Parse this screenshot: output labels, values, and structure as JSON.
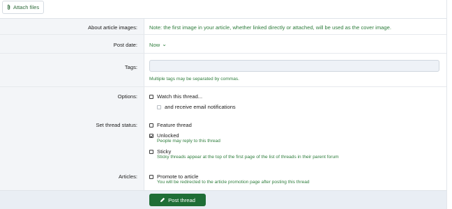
{
  "toolbar": {
    "attach_label": "Attach files"
  },
  "form": {
    "cover": {
      "label": "About article images:",
      "note": "Note: the first image in your article, whether linked directly or attached, will be used as the cover image."
    },
    "post_date": {
      "label": "Post date:",
      "value": "Now",
      "chevron": "⌄"
    },
    "tags": {
      "label": "Tags:",
      "value": "",
      "hint": "Multiple tags may be separated by commas."
    },
    "options": {
      "label": "Options:",
      "watch": {
        "label": "Watch this thread...",
        "checked": false
      },
      "email": {
        "label": "and receive email notifications",
        "checked": false
      }
    },
    "status": {
      "label": "Set thread status:",
      "feature": {
        "label": "Feature thread",
        "checked": false
      },
      "unlocked": {
        "label": "Unlocked",
        "checked": true,
        "hint": "People may reply to this thread"
      },
      "sticky": {
        "label": "Sticky",
        "checked": false,
        "hint": "Sticky threads appear at the top of the first page of the list of threads in their parent forum"
      }
    },
    "articles": {
      "label": "Articles:",
      "promote": {
        "label": "Promote to article",
        "checked": false,
        "hint": "You will be redirected to the article promotion page after posting this thread"
      }
    }
  },
  "footer": {
    "submit_label": "Post thread"
  },
  "colors": {
    "accent": "#1f6e36",
    "hint_green": "#2e7d3c",
    "label_bg": "#f3f5f8"
  }
}
